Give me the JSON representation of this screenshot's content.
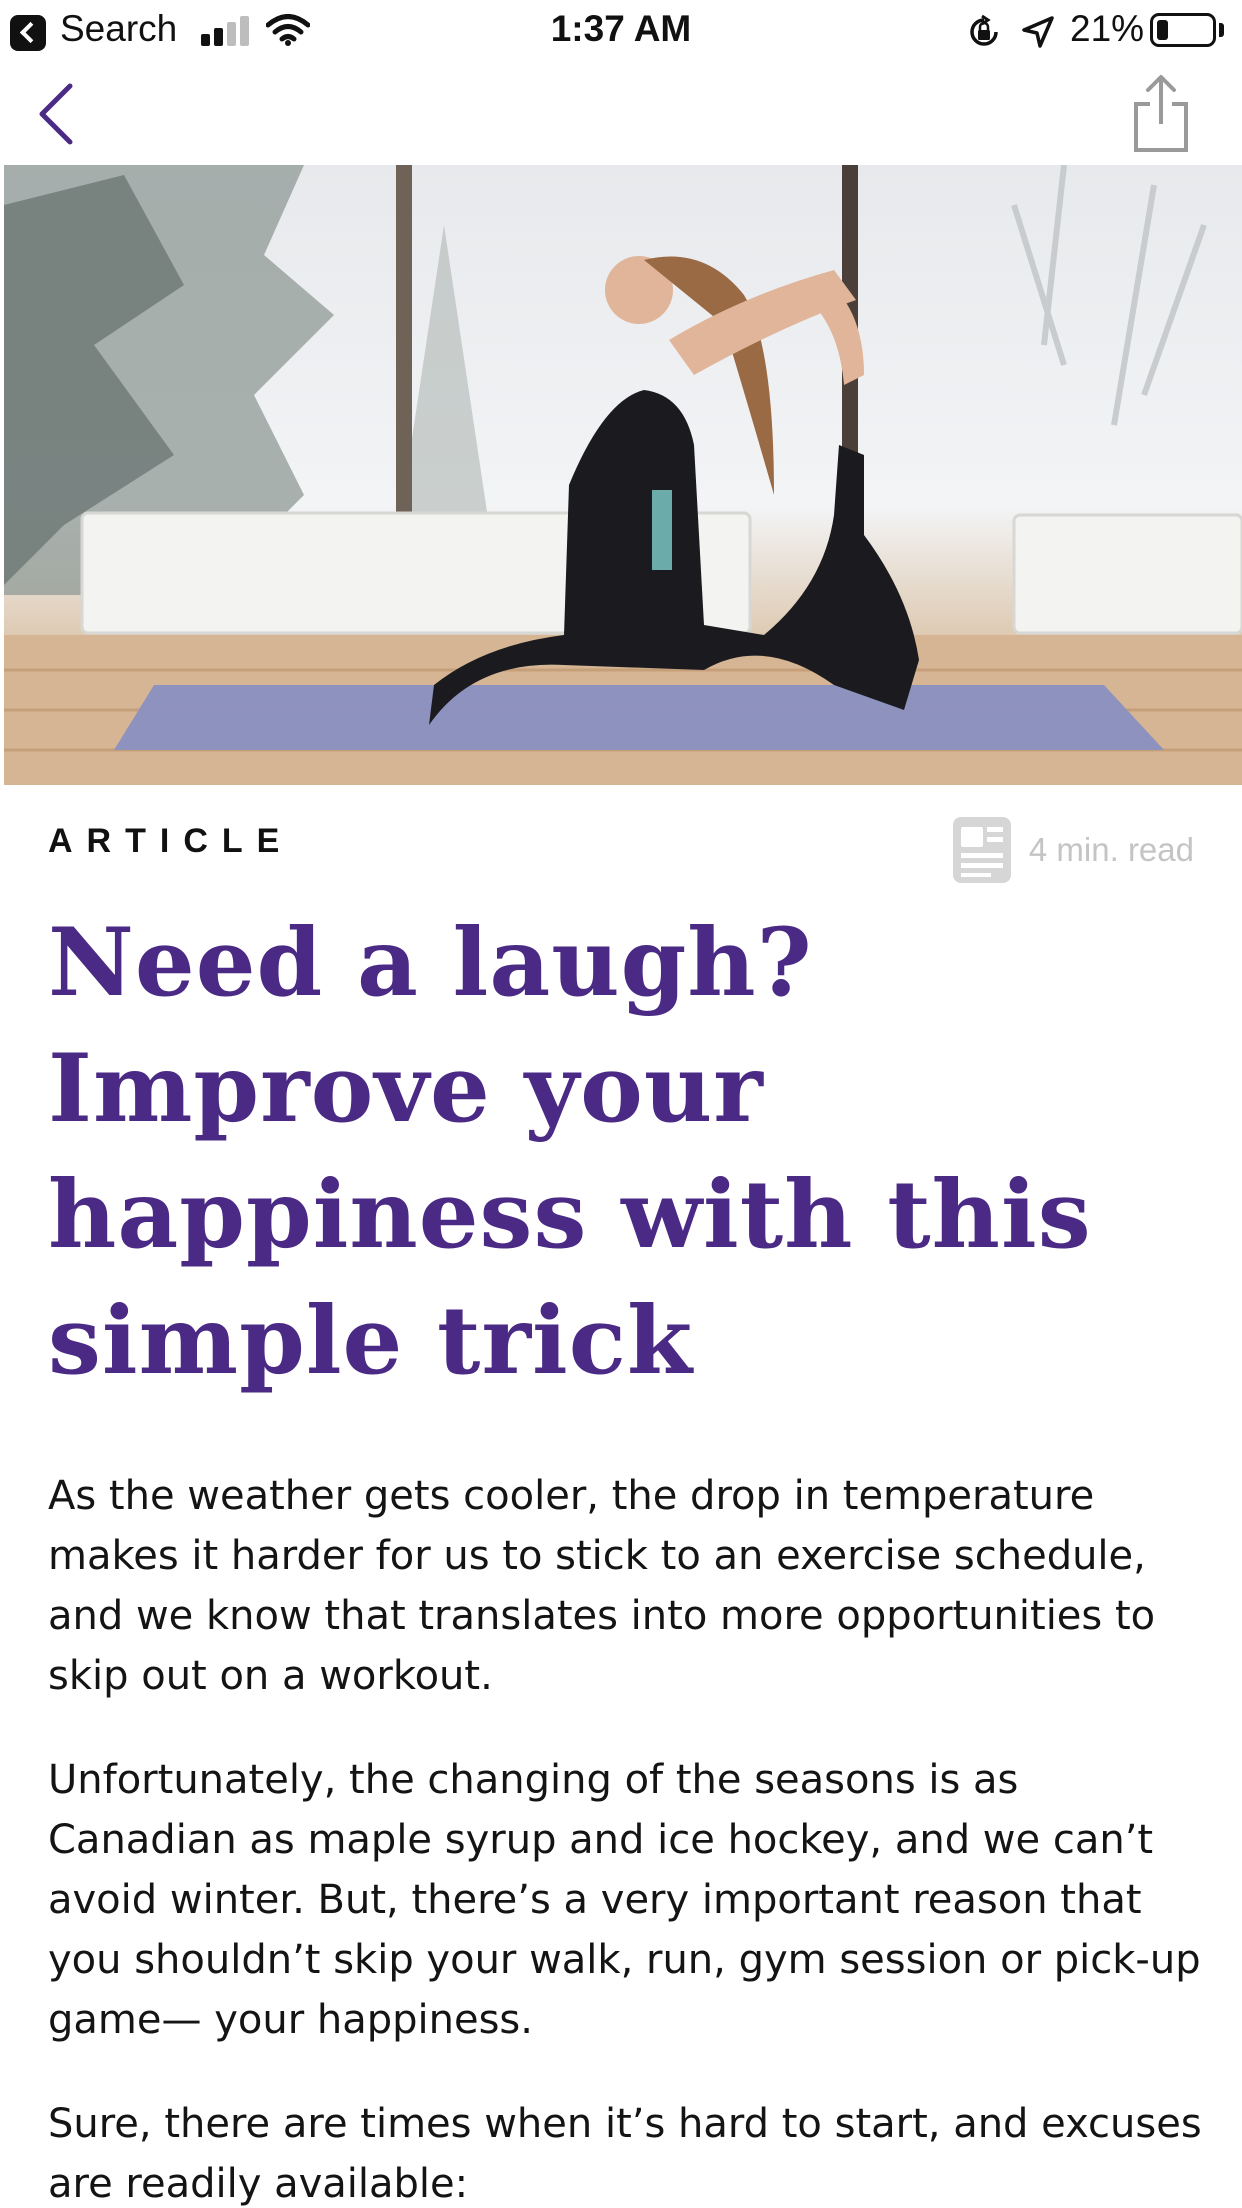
{
  "status_bar": {
    "back_label": "Search",
    "time": "1:37 AM",
    "battery_percent_text": "21%",
    "battery_level": 0.21
  },
  "nav": {
    "back_icon": "chevron-left-icon",
    "share_icon": "share-icon"
  },
  "hero": {
    "image": "yoga-pose-photo"
  },
  "article": {
    "category": "ARTICLE",
    "read_time": "4 min. read",
    "read_icon": "article-icon",
    "title": "Need a laugh? Improve your happiness with this simple trick",
    "paragraphs": [
      "As the weather gets cooler, the drop in temperature makes it harder for us to stick to an exercise schedule, and we know that translates into more opportunities to skip out on a workout.",
      "Unfortunately, the changing of the seasons is as Canadian as maple syrup and ice hockey, and we can’t avoid winter. But, there’s a very important reason that you shouldn’t skip your walk, run, gym session or pick-up game— your happiness.",
      "Sure, there are times when it’s hard to start, and excuses are readily available:"
    ]
  },
  "colors": {
    "accent": "#4a2a85",
    "text": "#141414",
    "muted": "#c4c4c4"
  }
}
